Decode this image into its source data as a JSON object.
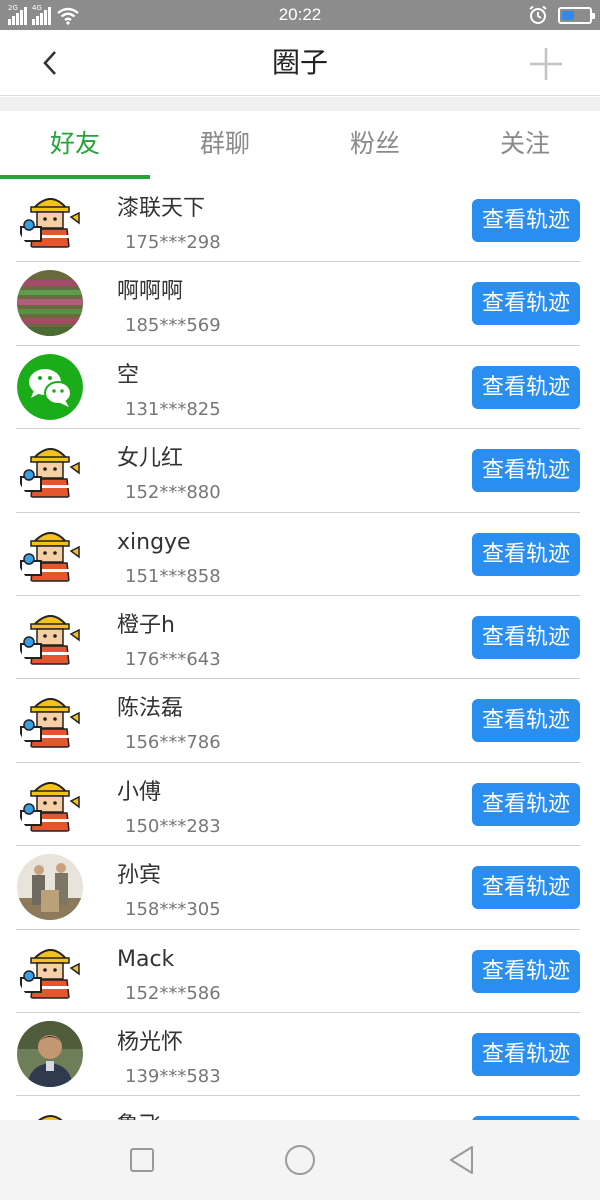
{
  "status_bar": {
    "signal1_label": "2G",
    "signal2_label": "4G",
    "time": "20:22",
    "battery_level": 0.45,
    "icons": [
      "signal-icon",
      "signal-icon",
      "wifi-icon",
      "alarm-icon",
      "battery-icon"
    ]
  },
  "header": {
    "title": "圈子",
    "back_icon": "chevron-left-icon",
    "add_icon": "plus-icon"
  },
  "tabs": [
    {
      "label": "好友",
      "active": true
    },
    {
      "label": "群聊",
      "active": false
    },
    {
      "label": "粉丝",
      "active": false
    },
    {
      "label": "关注",
      "active": false
    }
  ],
  "contacts": [
    {
      "name": "漆联天下",
      "phone": "175***298",
      "avatar": "worker"
    },
    {
      "name": "啊啊啊",
      "phone": "185***569",
      "avatar": "photo-field"
    },
    {
      "name": "空",
      "phone": "131***825",
      "avatar": "wechat"
    },
    {
      "name": "女儿红",
      "phone": "152***880",
      "avatar": "worker"
    },
    {
      "name": "xingye",
      "phone": "151***858",
      "avatar": "worker"
    },
    {
      "name": "橙子h",
      "phone": "176***643",
      "avatar": "worker"
    },
    {
      "name": "陈法磊",
      "phone": "156***786",
      "avatar": "worker"
    },
    {
      "name": "小傅",
      "phone": "150***283",
      "avatar": "worker"
    },
    {
      "name": "孙宾",
      "phone": "158***305",
      "avatar": "photo-people"
    },
    {
      "name": "Mack",
      "phone": "152***586",
      "avatar": "worker"
    },
    {
      "name": "杨光怀",
      "phone": "139***583",
      "avatar": "photo-man"
    },
    {
      "name": "鲁飞",
      "phone": "",
      "avatar": "worker"
    }
  ],
  "track_button_label": "查看轨迹",
  "nav_bar": {
    "icons": [
      "square-icon",
      "circle-icon",
      "triangle-back-icon"
    ]
  },
  "colors": {
    "accent_green": "#22a63a",
    "button_blue": "#2a8ef0",
    "status_bar": "#8c8c8c"
  }
}
